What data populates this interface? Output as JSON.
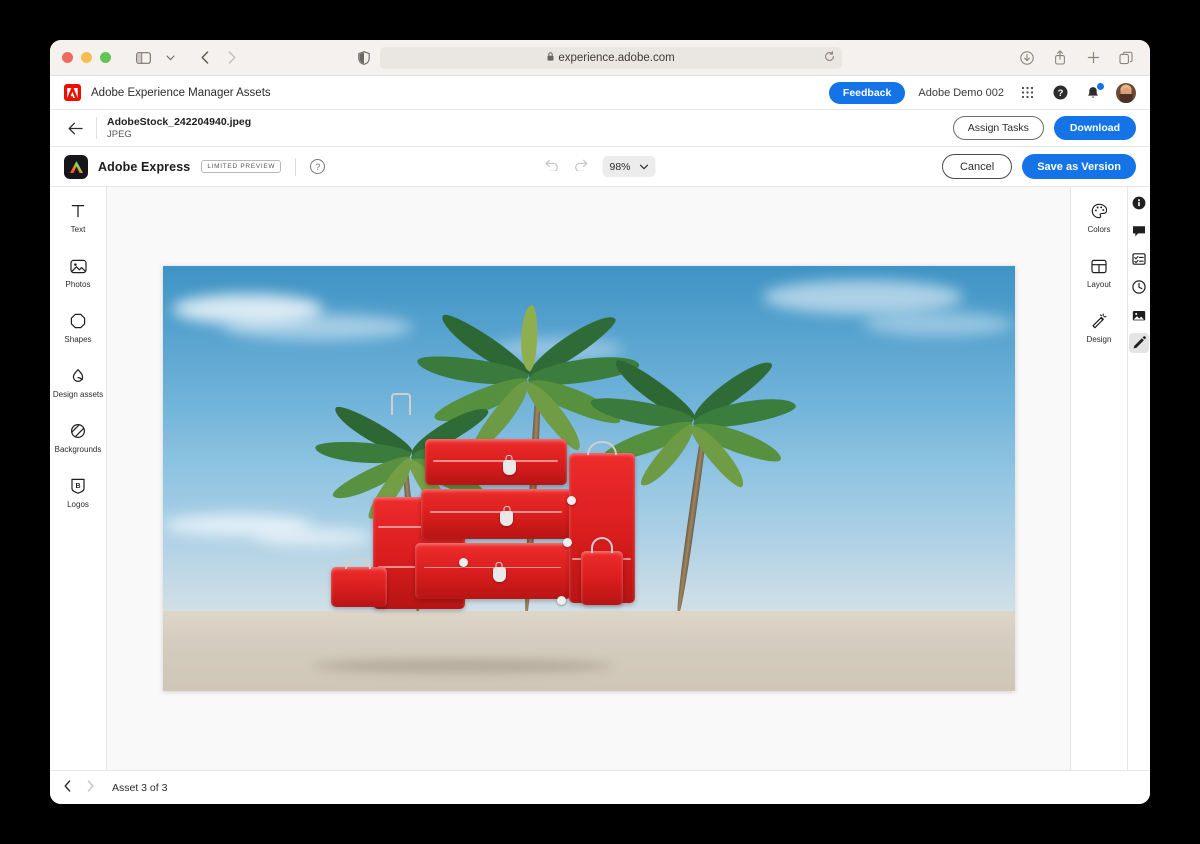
{
  "browser": {
    "url": "experience.adobe.com",
    "lock_icon": "lock-icon",
    "reload_icon": "reload-icon",
    "privacy_icon": "privacy-shield-icon",
    "back_icon": "back-chevron-icon",
    "forward_icon": "forward-chevron-icon",
    "sidebar_icon": "sidebar-toggle-icon",
    "sidebar_chevron": "chevron-down-icon",
    "downloads_icon": "downloads-icon",
    "share_icon": "share-icon",
    "newtab_icon": "plus-icon",
    "tabs_icon": "tab-overview-icon"
  },
  "aem_header": {
    "app_title": "Adobe Experience Manager Assets",
    "feedback_label": "Feedback",
    "org_name": "Adobe Demo 002",
    "apps_icon": "app-grid-icon",
    "help_icon": "help-circle-icon",
    "bell_icon": "notification-bell-icon",
    "avatar_icon": "user-avatar"
  },
  "asset_header": {
    "back_icon": "back-arrow-icon",
    "file_name": "AdobeStock_242204940.jpeg",
    "file_type": "JPEG",
    "assign_tasks_label": "Assign Tasks",
    "download_label": "Download"
  },
  "express_bar": {
    "app_name": "Adobe Express",
    "preview_badge": "LIMITED PREVIEW",
    "help_icon": "help-circle-icon",
    "undo_icon": "undo-icon",
    "redo_icon": "redo-icon",
    "zoom_value": "98%",
    "zoom_chevron": "chevron-down-icon",
    "cancel_label": "Cancel",
    "save_label": "Save as Version"
  },
  "left_tools": [
    {
      "label": "Text",
      "icon": "text-icon"
    },
    {
      "label": "Photos",
      "icon": "photos-icon"
    },
    {
      "label": "Shapes",
      "icon": "shapes-icon"
    },
    {
      "label": "Design assets",
      "icon": "design-assets-icon"
    },
    {
      "label": "Backgrounds",
      "icon": "backgrounds-icon"
    },
    {
      "label": "Logos",
      "icon": "logos-icon"
    }
  ],
  "right_tools": [
    {
      "label": "Colors",
      "icon": "colors-palette-icon"
    },
    {
      "label": "Layout",
      "icon": "layout-grid-icon"
    },
    {
      "label": "Design",
      "icon": "design-wand-icon"
    }
  ],
  "far_rail": [
    {
      "icon": "info-icon",
      "active": false
    },
    {
      "icon": "comment-icon",
      "active": false
    },
    {
      "icon": "tasks-icon",
      "active": false
    },
    {
      "icon": "timeline-history-icon",
      "active": false
    },
    {
      "icon": "renditions-image-icon",
      "active": false
    },
    {
      "icon": "edit-pencil-icon",
      "active": true
    }
  ],
  "canvas": {
    "image_alt": "Red luggage stack on sand beneath three palm trees against a blue sky"
  },
  "footer": {
    "prev_icon": "prev-chevron-icon",
    "next_icon": "next-chevron-icon",
    "asset_counter": "Asset 3 of 3"
  },
  "colors": {
    "accent_blue": "#1473e6",
    "adobe_red": "#eb1000",
    "luggage_red": "#e02020",
    "sky_blue": "#57a3cf"
  }
}
